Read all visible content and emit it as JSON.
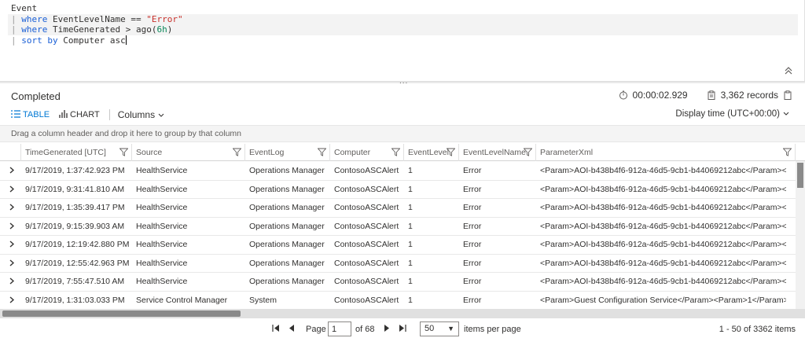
{
  "editor": {
    "lines": [
      {
        "pipe": "",
        "kw": "",
        "rest": "Event",
        "str": "",
        "num": "",
        "tail": ""
      },
      {
        "pipe": "| ",
        "kw": "where",
        "rest": " EventLevelName == ",
        "str": "\"Error\"",
        "num": "",
        "tail": ""
      },
      {
        "pipe": "| ",
        "kw": "where",
        "rest": " TimeGenerated > ago(",
        "str": "",
        "num": "6h",
        "tail": ")"
      },
      {
        "pipe": "| ",
        "kw": "sort by",
        "rest": " Computer asc",
        "str": "",
        "num": "",
        "tail": ""
      }
    ],
    "splitter_label": "..."
  },
  "results": {
    "status": "Completed",
    "duration": "00:00:02.929",
    "records": "3,362 records"
  },
  "toolbar": {
    "table_label": "TABLE",
    "chart_label": "CHART",
    "columns_label": "Columns",
    "display_time": "Display time (UTC+00:00)"
  },
  "group_hint": "Drag a column header and drop it here to group by that column",
  "table": {
    "columns": [
      "TimeGenerated [UTC]",
      "Source",
      "EventLog",
      "Computer",
      "EventLevel",
      "EventLevelName",
      "ParameterXml"
    ],
    "rows": [
      [
        "9/17/2019, 1:37:42.923 PM",
        "HealthService",
        "Operations Manager",
        "ContosoASCAlert",
        "1",
        "Error",
        "<Param>AOI-b438b4f6-912a-46d5-9cb1-b44069212abc</Param><P..."
      ],
      [
        "9/17/2019, 9:31:41.810 AM",
        "HealthService",
        "Operations Manager",
        "ContosoASCAlert",
        "1",
        "Error",
        "<Param>AOI-b438b4f6-912a-46d5-9cb1-b44069212abc</Param><P..."
      ],
      [
        "9/17/2019, 1:35:39.417 PM",
        "HealthService",
        "Operations Manager",
        "ContosoASCAlert",
        "1",
        "Error",
        "<Param>AOI-b438b4f6-912a-46d5-9cb1-b44069212abc</Param><P..."
      ],
      [
        "9/17/2019, 9:15:39.903 AM",
        "HealthService",
        "Operations Manager",
        "ContosoASCAlert",
        "1",
        "Error",
        "<Param>AOI-b438b4f6-912a-46d5-9cb1-b44069212abc</Param><P..."
      ],
      [
        "9/17/2019, 12:19:42.880 PM",
        "HealthService",
        "Operations Manager",
        "ContosoASCAlert",
        "1",
        "Error",
        "<Param>AOI-b438b4f6-912a-46d5-9cb1-b44069212abc</Param><P..."
      ],
      [
        "9/17/2019, 12:55:42.963 PM",
        "HealthService",
        "Operations Manager",
        "ContosoASCAlert",
        "1",
        "Error",
        "<Param>AOI-b438b4f6-912a-46d5-9cb1-b44069212abc</Param><P..."
      ],
      [
        "9/17/2019, 7:55:47.510 AM",
        "HealthService",
        "Operations Manager",
        "ContosoASCAlert",
        "1",
        "Error",
        "<Param>AOI-b438b4f6-912a-46d5-9cb1-b44069212abc</Param><P..."
      ],
      [
        "9/17/2019, 1:31:03.033 PM",
        "Service Control Manager",
        "System",
        "ContosoASCAlert",
        "1",
        "Error",
        "<Param>Guest Configuration Service</Param><Param>1</Param>..."
      ]
    ]
  },
  "pager": {
    "page_label": "Page",
    "page_value": "1",
    "of_label": "of 68",
    "page_size": "50",
    "items_per_page": "items per page",
    "count": "1 - 50 of 3362 items"
  },
  "colors": {
    "accent": "#0078d4",
    "keyword": "#1a5fd6",
    "string": "#c8302b",
    "number": "#098658"
  },
  "icons": {
    "stopwatch": "stopwatch-icon",
    "clipboard": "clipboard-icon",
    "table": "table-icon",
    "chart": "bar-chart-icon",
    "filter": "filter-icon",
    "collapse": "double-chevron-up-icon"
  }
}
